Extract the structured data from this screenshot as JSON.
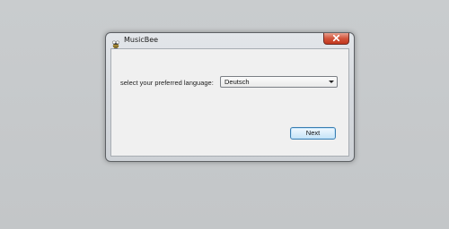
{
  "window": {
    "title": "MusicBee",
    "app_icon": "musicbee-bee-icon",
    "close_icon": "close-icon"
  },
  "form": {
    "language_label": "select your preferred language:",
    "language_selected": "Deutsch",
    "dropdown_icon": "chevron-down-icon",
    "next_label": "Next"
  },
  "colors": {
    "desktop_background": "#c6c9cb",
    "close_button": "#c2371e",
    "default_button_border": "#3c7fb1"
  }
}
